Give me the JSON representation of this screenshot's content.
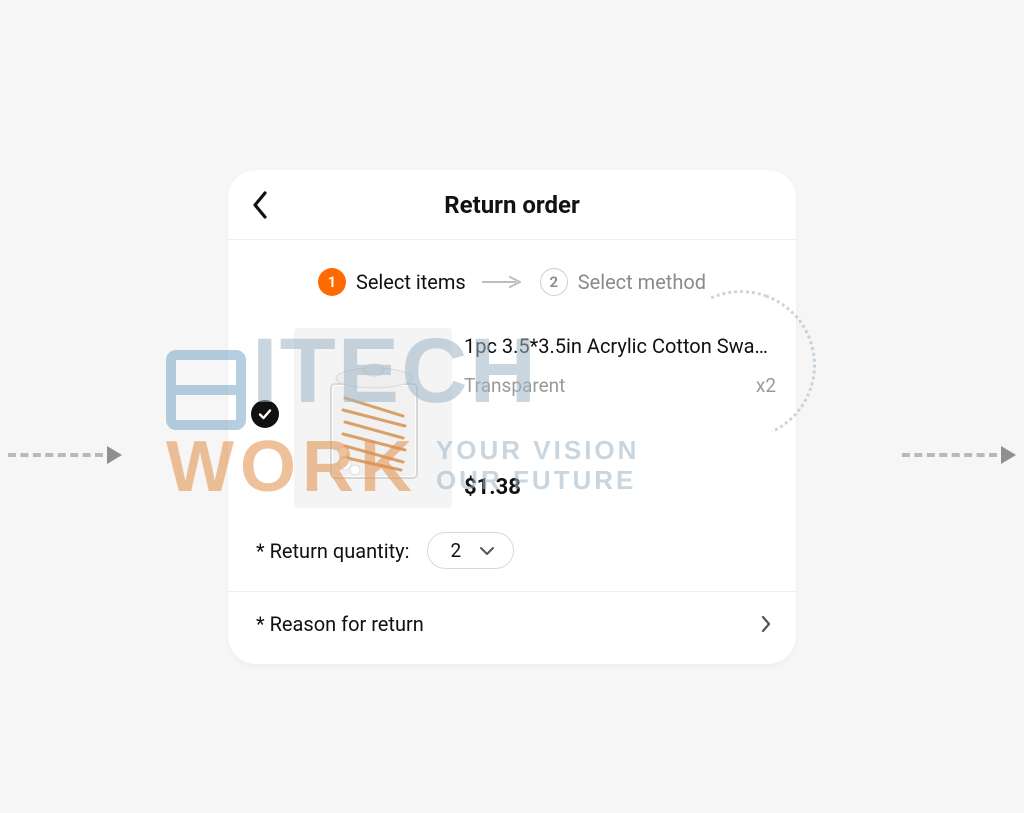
{
  "header": {
    "title": "Return order"
  },
  "stepper": {
    "step1_num": "1",
    "step1_label": "Select items",
    "step2_num": "2",
    "step2_label": "Select method"
  },
  "item": {
    "name": "1pc 3.5*3.5in Acrylic Cotton Swab…",
    "variant": "Transparent",
    "qty_label": "x2",
    "price": "$1.38"
  },
  "return_qty": {
    "label": "* Return quantity:",
    "value": "2"
  },
  "reason": {
    "label": "* Reason for return"
  },
  "watermark": {
    "brand1_prefix": "I",
    "brand1": "TECH",
    "brand2": "WORK",
    "tag1": "YOUR VISION",
    "tag2": "OUR FUTURE"
  },
  "colors": {
    "accent": "#ff6a00"
  }
}
